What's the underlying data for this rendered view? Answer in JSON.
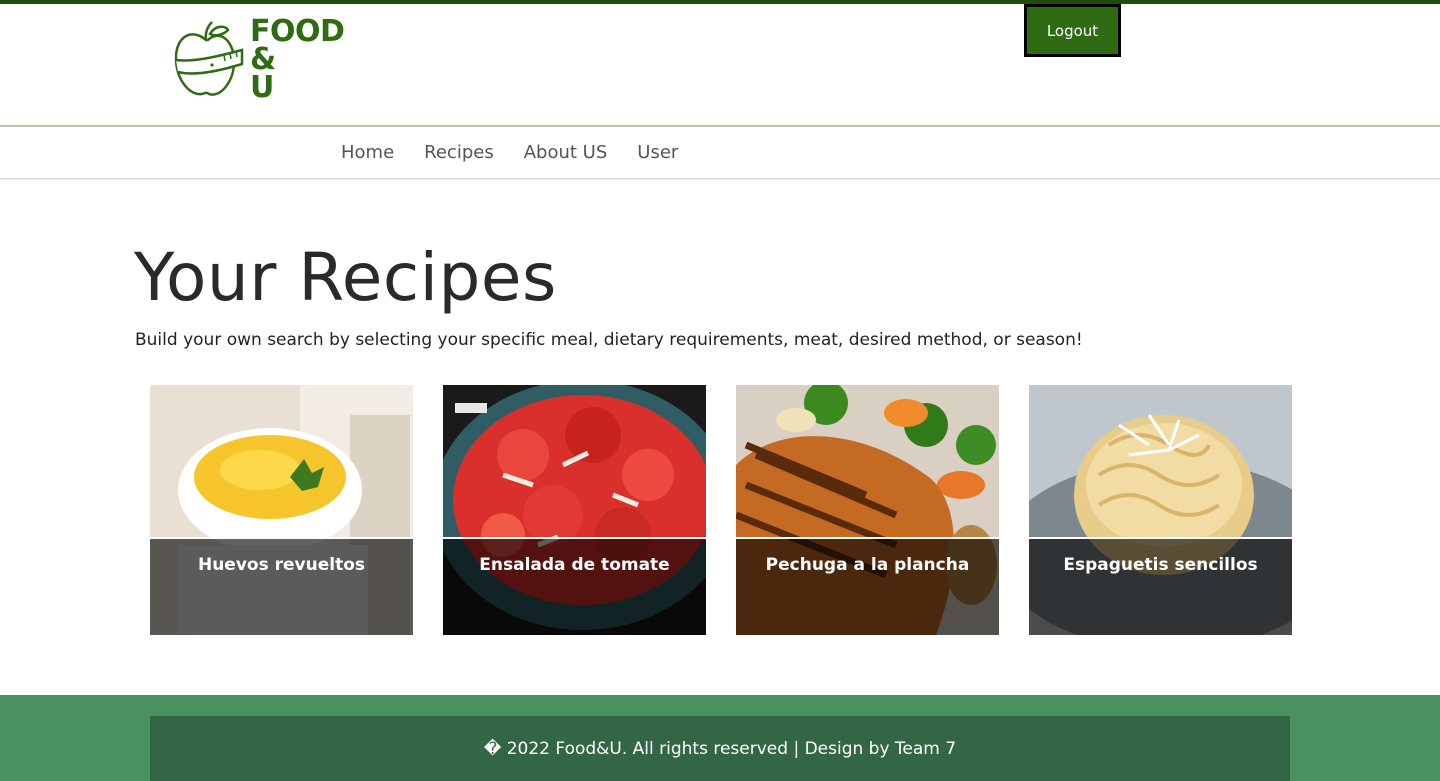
{
  "header": {
    "logo": {
      "line1": "FOOD",
      "line2": "&",
      "line3": "U"
    },
    "logout_label": "Logout"
  },
  "nav": {
    "items": [
      {
        "label": "Home"
      },
      {
        "label": "Recipes"
      },
      {
        "label": "About US"
      },
      {
        "label": "User"
      }
    ]
  },
  "main": {
    "title": "Your Recipes",
    "subtitle": "Build your own search by selecting your specific meal, dietary requirements, meat, desired method, or season!",
    "cards": [
      {
        "title": "Huevos revueltos",
        "image": "scrambled-eggs-photo"
      },
      {
        "title": "Ensalada de tomate",
        "image": "tomato-salad-photo"
      },
      {
        "title": "Pechuga a la plancha",
        "image": "grilled-chicken-photo"
      },
      {
        "title": "Espaguetis sencillos",
        "image": "spaghetti-photo"
      }
    ]
  },
  "footer": {
    "text": "� 2022 Food&U. All rights reserved | Design by Team 7"
  },
  "colors": {
    "brand_green": "#2e6b12",
    "top_line": "#1f4d0f",
    "footer_outer": "#4a9160",
    "footer_inner": "#336645"
  }
}
